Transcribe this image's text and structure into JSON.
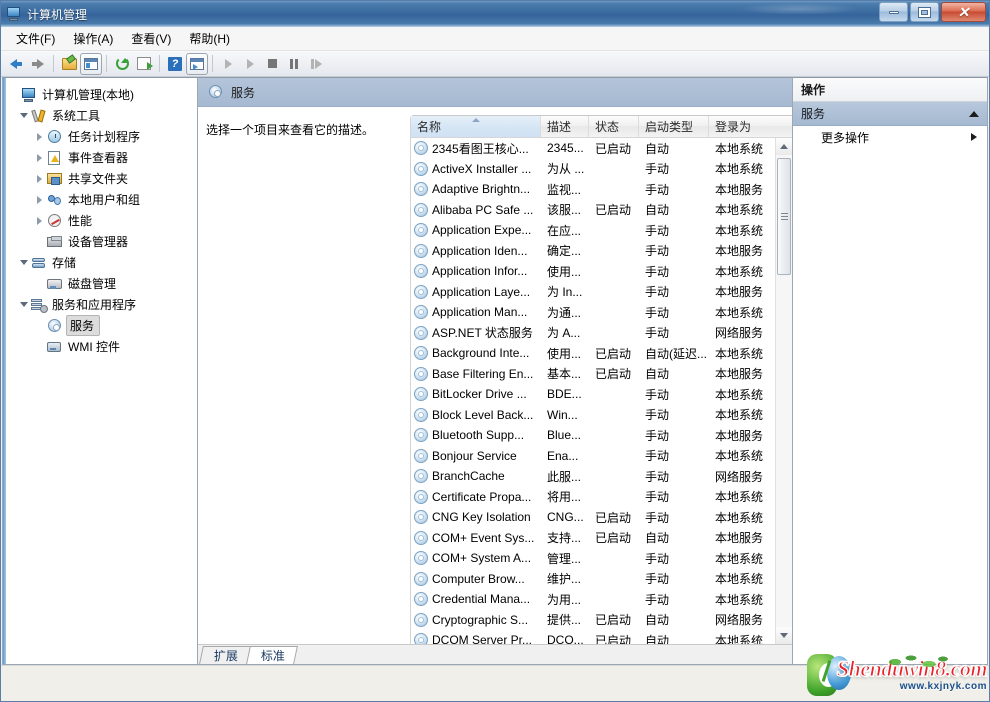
{
  "window": {
    "title": "计算机管理",
    "icon": "computer-management-icon",
    "minimize_label": "最小化",
    "maximize_label": "最大化",
    "close_label": "关闭",
    "close_glyph": "✕"
  },
  "menubar": {
    "items": [
      {
        "label": "文件(F)",
        "name": "menu-file"
      },
      {
        "label": "操作(A)",
        "name": "menu-action"
      },
      {
        "label": "查看(V)",
        "name": "menu-view"
      },
      {
        "label": "帮助(H)",
        "name": "menu-help"
      }
    ]
  },
  "toolbar": {
    "items": [
      {
        "name": "back-icon",
        "label": "后退"
      },
      {
        "name": "forward-icon",
        "label": "前进"
      },
      {
        "name": "up-folder-icon",
        "label": "向上一级"
      },
      {
        "name": "show-hide-tree-icon",
        "label": "显示/隐藏控制台树"
      },
      {
        "name": "refresh-icon",
        "label": "刷新"
      },
      {
        "name": "export-list-icon",
        "label": "导出列表"
      },
      {
        "name": "help-icon",
        "label": "帮助"
      },
      {
        "name": "show-action-pane-icon",
        "label": "显示/隐藏操作窗格"
      },
      {
        "name": "start-service-icon",
        "label": "启动服务"
      },
      {
        "name": "resume-service-icon",
        "label": "继续服务"
      },
      {
        "name": "stop-service-icon",
        "label": "停止服务"
      },
      {
        "name": "pause-service-icon",
        "label": "暂停服务"
      },
      {
        "name": "restart-service-icon",
        "label": "重启动服务"
      }
    ]
  },
  "tree": {
    "root": {
      "label": "计算机管理(本地)",
      "icon": "computer-icon",
      "level": 0,
      "twist": "none"
    },
    "nodes": [
      {
        "label": "系统工具",
        "icon": "tools-icon",
        "level": 1,
        "twist": "open",
        "selected": false
      },
      {
        "label": "任务计划程序",
        "icon": "clock-icon",
        "level": 2,
        "twist": "closed",
        "selected": false
      },
      {
        "label": "事件查看器",
        "icon": "event-viewer-icon",
        "level": 2,
        "twist": "closed",
        "selected": false
      },
      {
        "label": "共享文件夹",
        "icon": "shared-folder-icon",
        "level": 2,
        "twist": "closed",
        "selected": false
      },
      {
        "label": "本地用户和组",
        "icon": "users-icon",
        "level": 2,
        "twist": "closed",
        "selected": false
      },
      {
        "label": "性能",
        "icon": "performance-icon",
        "level": 2,
        "twist": "closed",
        "selected": false
      },
      {
        "label": "设备管理器",
        "icon": "device-manager-icon",
        "level": 2,
        "twist": "none",
        "selected": false
      },
      {
        "label": "存储",
        "icon": "storage-icon",
        "level": 1,
        "twist": "open",
        "selected": false
      },
      {
        "label": "磁盘管理",
        "icon": "disk-management-icon",
        "level": 2,
        "twist": "none",
        "selected": false
      },
      {
        "label": "服务和应用程序",
        "icon": "services-apps-icon",
        "level": 1,
        "twist": "open",
        "selected": false
      },
      {
        "label": "服务",
        "icon": "service-gear-icon",
        "level": 2,
        "twist": "none",
        "selected": true
      },
      {
        "label": "WMI 控件",
        "icon": "wmi-control-icon",
        "level": 2,
        "twist": "none",
        "selected": false
      }
    ]
  },
  "middle": {
    "header_title": "服务",
    "header_icon": "service-gear-icon",
    "description_placeholder": "选择一个项目来查看它的描述。",
    "columns": [
      {
        "label": "名称",
        "width": 130,
        "sorted": true,
        "name": "column-name"
      },
      {
        "label": "描述",
        "width": 48,
        "sorted": false,
        "name": "column-description"
      },
      {
        "label": "状态",
        "width": 50,
        "sorted": false,
        "name": "column-status"
      },
      {
        "label": "启动类型",
        "width": 70,
        "sorted": false,
        "name": "column-startup-type"
      },
      {
        "label": "登录为",
        "width": 64,
        "sorted": false,
        "name": "column-logon-as"
      }
    ],
    "rows": [
      {
        "name": "2345看图王核心...",
        "desc": "2345...",
        "status": "已启动",
        "startup": "自动",
        "logon": "本地系统"
      },
      {
        "name": "ActiveX Installer ...",
        "desc": "为从 ...",
        "status": "",
        "startup": "手动",
        "logon": "本地系统"
      },
      {
        "name": "Adaptive Brightn...",
        "desc": "监视...",
        "status": "",
        "startup": "手动",
        "logon": "本地服务"
      },
      {
        "name": "Alibaba PC Safe ...",
        "desc": "该服...",
        "status": "已启动",
        "startup": "自动",
        "logon": "本地系统"
      },
      {
        "name": "Application Expe...",
        "desc": "在应...",
        "status": "",
        "startup": "手动",
        "logon": "本地系统"
      },
      {
        "name": "Application Iden...",
        "desc": "确定...",
        "status": "",
        "startup": "手动",
        "logon": "本地服务"
      },
      {
        "name": "Application Infor...",
        "desc": "使用...",
        "status": "",
        "startup": "手动",
        "logon": "本地系统"
      },
      {
        "name": "Application Laye...",
        "desc": "为 In...",
        "status": "",
        "startup": "手动",
        "logon": "本地服务"
      },
      {
        "name": "Application Man...",
        "desc": "为通...",
        "status": "",
        "startup": "手动",
        "logon": "本地系统"
      },
      {
        "name": "ASP.NET 状态服务",
        "desc": "为 A...",
        "status": "",
        "startup": "手动",
        "logon": "网络服务"
      },
      {
        "name": "Background Inte...",
        "desc": "使用...",
        "status": "已启动",
        "startup": "自动(延迟...",
        "logon": "本地系统"
      },
      {
        "name": "Base Filtering En...",
        "desc": "基本...",
        "status": "已启动",
        "startup": "自动",
        "logon": "本地服务"
      },
      {
        "name": "BitLocker Drive ...",
        "desc": "BDE...",
        "status": "",
        "startup": "手动",
        "logon": "本地系统"
      },
      {
        "name": "Block Level Back...",
        "desc": "Win...",
        "status": "",
        "startup": "手动",
        "logon": "本地系统"
      },
      {
        "name": "Bluetooth Supp...",
        "desc": "Blue...",
        "status": "",
        "startup": "手动",
        "logon": "本地服务"
      },
      {
        "name": "Bonjour Service",
        "desc": "Ena...",
        "status": "",
        "startup": "手动",
        "logon": "本地系统"
      },
      {
        "name": "BranchCache",
        "desc": "此服...",
        "status": "",
        "startup": "手动",
        "logon": "网络服务"
      },
      {
        "name": "Certificate Propa...",
        "desc": "将用...",
        "status": "",
        "startup": "手动",
        "logon": "本地系统"
      },
      {
        "name": "CNG Key Isolation",
        "desc": "CNG...",
        "status": "已启动",
        "startup": "手动",
        "logon": "本地系统"
      },
      {
        "name": "COM+ Event Sys...",
        "desc": "支持...",
        "status": "已启动",
        "startup": "自动",
        "logon": "本地服务"
      },
      {
        "name": "COM+ System A...",
        "desc": "管理...",
        "status": "",
        "startup": "手动",
        "logon": "本地系统"
      },
      {
        "name": "Computer Brow...",
        "desc": "维护...",
        "status": "",
        "startup": "手动",
        "logon": "本地系统"
      },
      {
        "name": "Credential Mana...",
        "desc": "为用...",
        "status": "",
        "startup": "手动",
        "logon": "本地系统"
      },
      {
        "name": "Cryptographic S...",
        "desc": "提供...",
        "status": "已启动",
        "startup": "自动",
        "logon": "网络服务"
      },
      {
        "name": "DCOM Server Pr...",
        "desc": "DCO...",
        "status": "已启动",
        "startup": "自动",
        "logon": "本地系统"
      }
    ],
    "tabs": [
      {
        "label": "扩展",
        "active": false,
        "name": "tab-extended"
      },
      {
        "label": "标准",
        "active": true,
        "name": "tab-standard"
      }
    ],
    "scrollbar": {
      "up_label": "向上滚动",
      "down_label": "向下滚动"
    }
  },
  "actions": {
    "title": "操作",
    "group_label": "服务",
    "group_icon": "collapse-up-icon",
    "items": [
      {
        "label": "更多操作",
        "submenu_icon": "submenu-arrow-icon",
        "name": "action-more-actions"
      }
    ]
  },
  "watermark": {
    "primary": "Shenduwin8.com",
    "secondary": "www.kxjnyk.com"
  },
  "colors": {
    "titlebar_blue": "#38699f",
    "header_blue": "#a6b9d1",
    "accent_blue": "#2f7fc4",
    "close_red": "#c94b33",
    "watermark_red": "#e8232a",
    "watermark_blue": "#1b4f8c"
  }
}
